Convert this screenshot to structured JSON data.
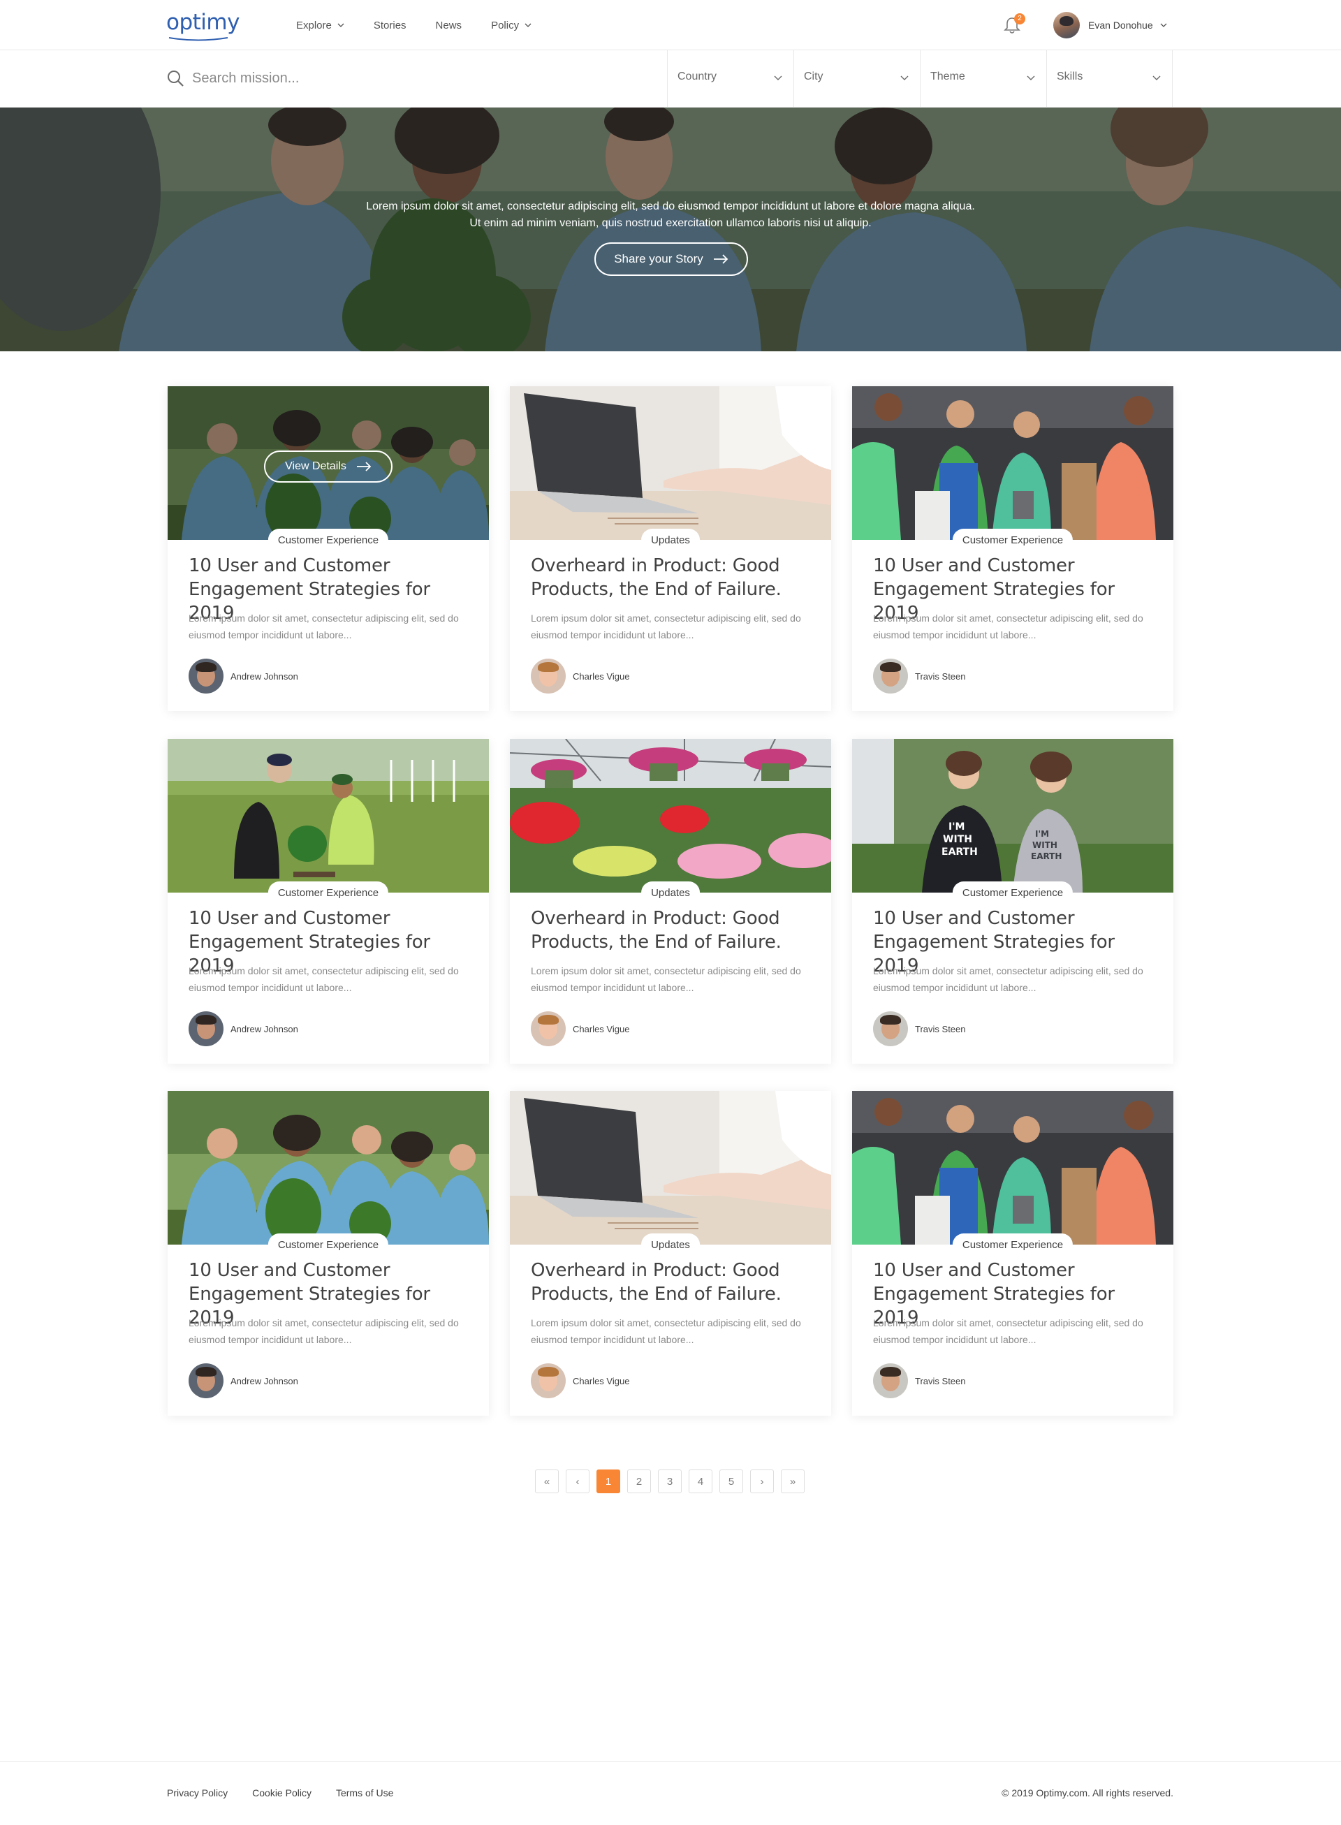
{
  "header": {
    "logo": "optimy",
    "nav": [
      {
        "label": "Explore",
        "has_dropdown": true
      },
      {
        "label": "Stories",
        "has_dropdown": false
      },
      {
        "label": "News",
        "has_dropdown": false
      },
      {
        "label": "Policy",
        "has_dropdown": true
      }
    ],
    "notification_count": "2",
    "user_name": "Evan Donohue"
  },
  "search": {
    "placeholder": "Search mission...",
    "filters": [
      {
        "label": "Country"
      },
      {
        "label": "City"
      },
      {
        "label": "Theme"
      },
      {
        "label": "Skills"
      }
    ]
  },
  "hero": {
    "text": "Lorem ipsum dolor sit amet, consectetur adipiscing elit, sed do eiusmod tempor incididunt ut labore et dolore magna aliqua. Ut enim ad minim veniam, quis nostrud exercitation ullamco laboris nisi ut aliquip.",
    "button_label": "Share your Story"
  },
  "cards": [
    {
      "tag": "Customer Experience",
      "title": "10 User and Customer Engagement Strategies for 2019",
      "description": "Lorem ipsum dolor sit amet, consectetur adipiscing elit, sed do eiusmod tempor incididunt ut labore...",
      "author": "Andrew Johnson",
      "image": "volunteers-group",
      "hovered": true
    },
    {
      "tag": "Updates",
      "title": "Overheard in Product: Good Products, the End of Failure.",
      "description": "Lorem ipsum dolor sit amet, consectetur adipiscing elit, sed do eiusmod tempor incididunt ut labore...",
      "author": "Charles Vigue",
      "image": "laptop-typing",
      "hovered": false
    },
    {
      "tag": "Customer Experience",
      "title": "10 User and Customer Engagement Strategies for 2019",
      "description": "Lorem ipsum dolor sit amet, consectetur adipiscing elit, sed do eiusmod tempor incididunt ut labore...",
      "author": "Travis Steen",
      "image": "food-drive",
      "hovered": false
    },
    {
      "tag": "Customer Experience",
      "title": "10 User and Customer Engagement Strategies for 2019",
      "description": "Lorem ipsum dolor sit amet, consectetur adipiscing elit, sed do eiusmod tempor incididunt ut labore...",
      "author": "Andrew Johnson",
      "image": "tree-planting",
      "hovered": false
    },
    {
      "tag": "Updates",
      "title": "Overheard in Product: Good Products, the End of Failure.",
      "description": "Lorem ipsum dolor sit amet, consectetur adipiscing elit, sed do eiusmod tempor incididunt ut labore...",
      "author": "Charles Vigue",
      "image": "greenhouse-flowers",
      "hovered": false
    },
    {
      "tag": "Customer Experience",
      "title": "10 User and Customer Engagement Strategies for 2019",
      "description": "Lorem ipsum dolor sit amet, consectetur adipiscing elit, sed do eiusmod tempor incididunt ut labore...",
      "author": "Travis Steen",
      "image": "earth-shirts",
      "hovered": false
    },
    {
      "tag": "Customer Experience",
      "title": "10 User and Customer Engagement Strategies for 2019",
      "description": "Lorem ipsum dolor sit amet, consectetur adipiscing elit, sed do eiusmod tempor incididunt ut labore...",
      "author": "Andrew Johnson",
      "image": "volunteers-group",
      "hovered": false
    },
    {
      "tag": "Updates",
      "title": "Overheard in Product: Good Products, the End of Failure.",
      "description": "Lorem ipsum dolor sit amet, consectetur adipiscing elit, sed do eiusmod tempor incididunt ut labore...",
      "author": "Charles Vigue",
      "image": "laptop-typing",
      "hovered": false
    },
    {
      "tag": "Customer Experience",
      "title": "10 User and Customer Engagement Strategies for 2019",
      "description": "Lorem ipsum dolor sit amet, consectetur adipiscing elit, sed do eiusmod tempor incididunt ut labore...",
      "author": "Travis Steen",
      "image": "food-drive",
      "hovered": false
    }
  ],
  "card_hover_button": "View Details",
  "pagination": {
    "first": "«",
    "prev": "‹",
    "pages": [
      "1",
      "2",
      "3",
      "4",
      "5"
    ],
    "current": "1",
    "next": "›",
    "last": "»"
  },
  "footer": {
    "links": [
      "Privacy Policy",
      "Cookie Policy",
      "Terms of Use"
    ],
    "copyright": "© 2019 Optimy.com. All rights reserved."
  },
  "colors": {
    "brand_blue": "#2f5fb0",
    "accent_orange": "#f88634",
    "text": "#414141",
    "muted_text": "#8a8a8a",
    "border": "#e8e8e8"
  }
}
